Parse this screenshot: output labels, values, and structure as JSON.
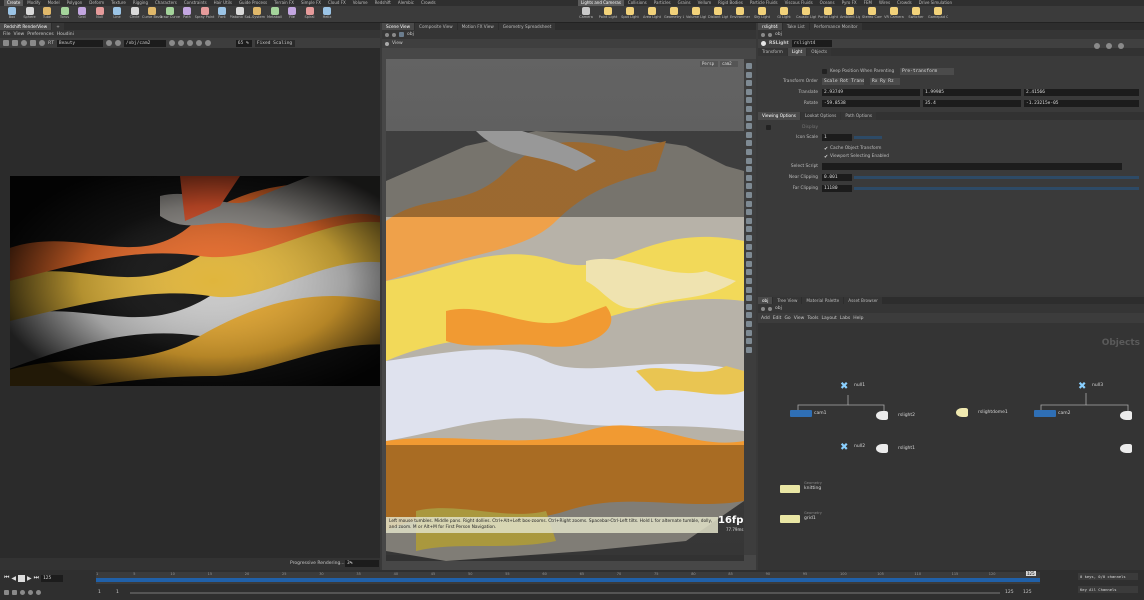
{
  "shelf_tabs_left": [
    "Create",
    "Modify",
    "Model",
    "Polygon",
    "Deform",
    "Texture",
    "Rigging",
    "Characters",
    "Constraints",
    "Hair Utils",
    "Guide Process",
    "Terrain FX",
    "Simple FX",
    "Cloud FX",
    "Volume",
    "Redshift",
    "Alembic",
    "Crowds"
  ],
  "shelf_tabs_right": [
    "Lights and Cameras",
    "Collisions",
    "Particles",
    "Grains",
    "Vellum",
    "Rigid Bodies",
    "Particle Fluids",
    "Viscous Fluids",
    "Oceans",
    "Pyro FX",
    "FEM",
    "Wires",
    "Crowds",
    "Drive Simulation"
  ],
  "shelf_tools_left": [
    "Box",
    "Sphere",
    "Tube",
    "Torus",
    "Grid",
    "Null",
    "Line",
    "Circle",
    "Curve Bezier",
    "Draw Curve",
    "Path",
    "Spray Paint",
    "Font",
    "Platonic Solids",
    "L-System",
    "Metaball",
    "File",
    "Spiral",
    "Helix"
  ],
  "shelf_tools_right": [
    "Camera",
    "Point Light",
    "Spot Light",
    "Area Light",
    "Geometry Light",
    "Volume Light",
    "Distant Light",
    "Environment Light",
    "Sky Light",
    "GI Light",
    "Caustic Light",
    "Portal Light",
    "Ambient Light",
    "Stereo Camera",
    "VR Camera",
    "Switcher",
    "Gamepad Camera"
  ],
  "render_view": {
    "tab": "Redshift RenderView",
    "menu": [
      "File",
      "View",
      "Preferences",
      "Houdini"
    ],
    "rt_label": "RT",
    "aov": "Beauty",
    "camera": "/obj/cam2",
    "zoom": "65 %",
    "scaling": "Fixed Scaling",
    "status": "Progressive Rendering...",
    "progress": "3%"
  },
  "scene_view": {
    "tabs": [
      "Scene View",
      "Composite View",
      "Motion FX View",
      "Geometry Spreadsheet"
    ],
    "path": "obj",
    "view_label": "View",
    "persp": "Persp",
    "cam": "cam2",
    "fps": "16fps",
    "fps_sub": "77.79ms",
    "help": "Left mouse tumbles. Middle pans. Right dollies. Ctrl+Alt+Left box-zooms. Ctrl+Right zooms. Spacebar-Ctrl-Left tilts. Hold L for alternate tumble, dolly, and zoom.    M or Alt+M for First Person Navigation."
  },
  "params": {
    "tabs": [
      "rslight4",
      "Take List",
      "Performance Monitor"
    ],
    "path": "obj",
    "type": "RSLight",
    "name": "rslight4",
    "main_tabs": [
      "Transform",
      "Light",
      "Objects"
    ],
    "keep_position": "Keep Position When Parenting",
    "keep_position_value": "Pre-transform",
    "transform_order_label": "Transform Order",
    "transform_order": "Scale Rot Trans",
    "rot_order": "Rx Ry Rz",
    "translate_label": "Translate",
    "translate": [
      "2.93749",
      "1.99985",
      "2.41566"
    ],
    "rotate_label": "Rotate",
    "rotate": [
      "-59.8538",
      "35.4",
      "-1.23215e-05"
    ],
    "sub_tabs": [
      "Viewing Options",
      "Lookat Options",
      "Path Options"
    ],
    "display_label": "Display",
    "icon_scale_label": "Icon Scale",
    "icon_scale": "1",
    "cache_transform": "Cache Object Transform",
    "viewport_selecting": "Viewport Selecting Enabled",
    "select_script_label": "Select Script",
    "near_clip_label": "Near Clipping",
    "near_clip": "0.001",
    "far_clip_label": "Far Clipping",
    "far_clip": "11180"
  },
  "network": {
    "tabs": [
      "obj",
      "Tree View",
      "Material Palette",
      "Asset Browser"
    ],
    "path": "obj",
    "menu": [
      "Add",
      "Edit",
      "Go",
      "View",
      "Tools",
      "Layout",
      "Labs",
      "Help"
    ],
    "watermark": "Objects",
    "nodes": {
      "null1": "null1",
      "cam1": "cam1",
      "rslight2": "rslight2",
      "null2": "null2",
      "rslight1": "rslight1",
      "rslightdome1": "rslightdome1",
      "null3": "null3",
      "cam2": "cam2",
      "knitting": "knitting",
      "grid1": "grid1",
      "knitting_tag": "Geometry",
      "grid1_tag": "Geometry"
    }
  },
  "timeline": {
    "frame": "125",
    "start": "1",
    "start2": "1",
    "end": "125",
    "end2": "125",
    "keys": "0 keys, 0/0 channels",
    "key_all": "Key All Channels",
    "ticks": [
      "1",
      "5",
      "10",
      "15",
      "20",
      "25",
      "30",
      "35",
      "40",
      "45",
      "50",
      "55",
      "60",
      "65",
      "70",
      "75",
      "80",
      "85",
      "90",
      "95",
      "100",
      "105",
      "110",
      "115",
      "120",
      "125"
    ]
  },
  "colors": {
    "accent": "#2f6fb5",
    "orange": "#f0962a",
    "yellow": "#f2d24a",
    "gray": "#aaa49a",
    "white": "#e2e4ec"
  }
}
